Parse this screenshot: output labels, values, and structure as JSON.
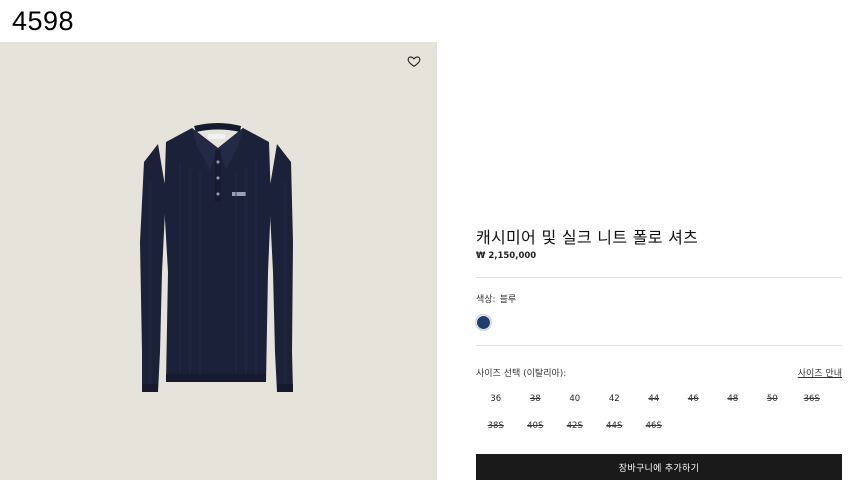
{
  "page": {
    "id_label": "4598"
  },
  "product": {
    "name": "캐시미어 및 실크 니트 폴로 셔츠",
    "price": "₩ 2,150,000",
    "color": {
      "label": "색상:",
      "value": "블루",
      "swatch_color": "#1f3f6e"
    },
    "size_label": "사이즈 선택 (이탈리아):",
    "size_guide": "사이즈 안내",
    "sizes": [
      {
        "label": "36",
        "available": true
      },
      {
        "label": "38",
        "available": false
      },
      {
        "label": "40",
        "available": true
      },
      {
        "label": "42",
        "available": true
      },
      {
        "label": "44",
        "available": false
      },
      {
        "label": "46",
        "available": false
      },
      {
        "label": "48",
        "available": false
      },
      {
        "label": "50",
        "available": false
      },
      {
        "label": "36S",
        "available": false
      },
      {
        "label": "38S",
        "available": false
      },
      {
        "label": "40S",
        "available": false
      },
      {
        "label": "42S",
        "available": false
      },
      {
        "label": "44S",
        "available": false
      },
      {
        "label": "46S",
        "available": false
      }
    ],
    "add_to_cart": "장바구니에 추가하기"
  },
  "gallery": {
    "background": "#e6e3da",
    "garment_color": "#1b2138"
  },
  "icons": {
    "wishlist": "heart-outline-icon"
  }
}
